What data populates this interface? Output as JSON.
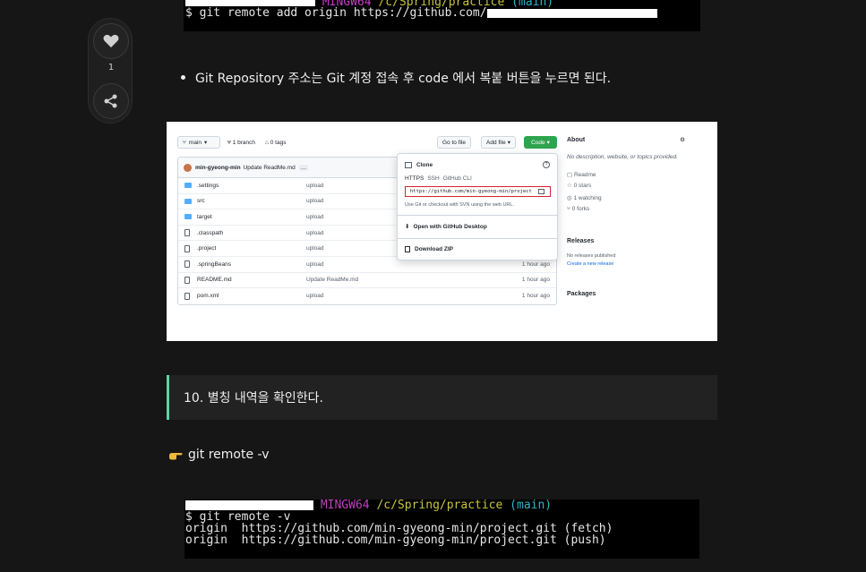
{
  "terminal_top": {
    "prompt_env": "MINGW64",
    "prompt_path": "/c/Spring/practice",
    "prompt_branch": "(main)",
    "command": "$ git remote add origin https://github.com/"
  },
  "side_actions": {
    "like_count": "1",
    "like_icon": "heart-icon",
    "share_icon": "share-icon"
  },
  "bullet_text": "Git Repository 주소는 Git 계정 접속 후 code 에서 복붙 버튼을 누르면 된다.",
  "github": {
    "branch_button": "main",
    "branch_count": "1 branch",
    "tag_count": "0 tags",
    "goto_file": "Go to file",
    "add_file": "Add file",
    "code_button": "Code",
    "commit_author": "min-gyeong-min",
    "commit_message": "Update ReadMe.md",
    "files": [
      {
        "name": ".settings",
        "message": "upload",
        "time": "",
        "type": "folder"
      },
      {
        "name": "src",
        "message": "upload",
        "time": "",
        "type": "folder"
      },
      {
        "name": "target",
        "message": "upload",
        "time": "",
        "type": "folder"
      },
      {
        "name": ".classpath",
        "message": "upload",
        "time": "",
        "type": "file"
      },
      {
        "name": ".project",
        "message": "upload",
        "time": "",
        "type": "file"
      },
      {
        "name": ".springBeans",
        "message": "upload",
        "time": "1 hour ago",
        "type": "file"
      },
      {
        "name": "README.md",
        "message": "Update ReadMe.md",
        "time": "1 hour ago",
        "type": "file"
      },
      {
        "name": "pom.xml",
        "message": "upload",
        "time": "1 hour ago",
        "type": "file"
      }
    ],
    "clone": {
      "title": "Clone",
      "tabs": [
        "HTTPS",
        "SSH",
        "GitHub CLI"
      ],
      "url": "https://github.com/min-gyeong-min/project",
      "hint": "Use Git or checkout with SVN using the web URL.",
      "open_desktop": "Open with GitHub Desktop",
      "download_zip": "Download ZIP"
    },
    "about": {
      "title": "About",
      "description": "No description, website, or topics provided.",
      "readme": "Readme",
      "stars": "0 stars",
      "watching": "1 watching",
      "forks": "0 forks",
      "releases_title": "Releases",
      "releases_none": "No releases published",
      "releases_link": "Create a new release",
      "packages_title": "Packages"
    }
  },
  "callout_text": "10. 별칭 내역을 확인한다.",
  "pointer_text": "git remote -v",
  "terminal_bottom": {
    "prompt_env": "MINGW64",
    "prompt_path": "/c/Spring/practice",
    "prompt_branch": "(main)",
    "line1": "$ git remote -v",
    "line2": "origin  https://github.com/min-gyeong-min/project.git (fetch)",
    "line3": "origin  https://github.com/min-gyeong-min/project.git (push)"
  },
  "colors": {
    "background": "#161616",
    "callout_accent": "#5fd3a2",
    "terminal_magenta": "#c23ec2",
    "terminal_yellow": "#c7c43b",
    "terminal_cyan": "#2fb3c7",
    "github_green": "#2da44e",
    "highlight_red": "#d1242f"
  }
}
